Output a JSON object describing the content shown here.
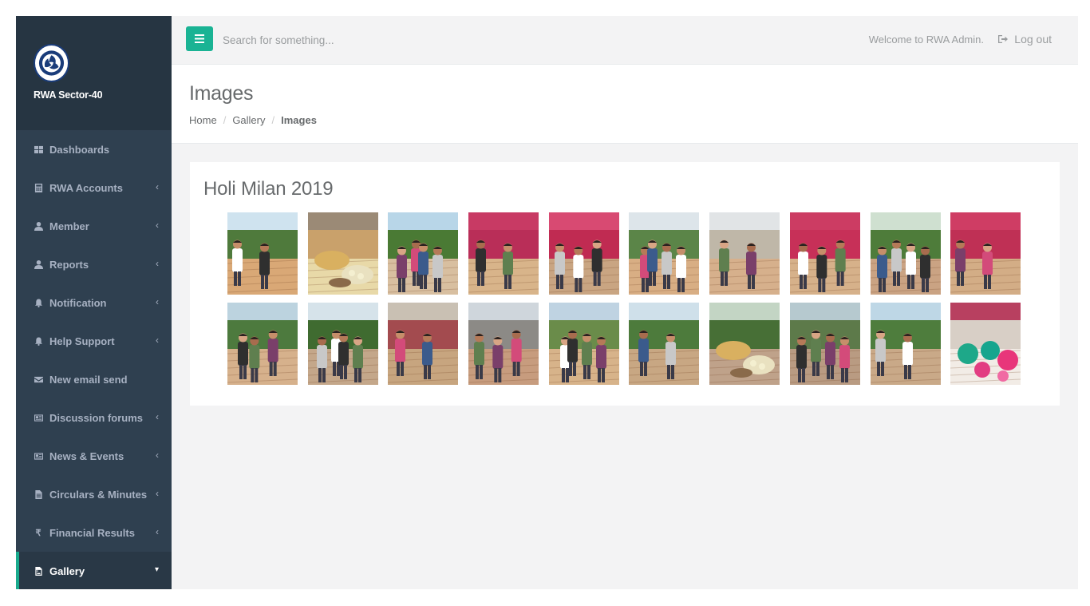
{
  "brand": {
    "org_name": "RWA Sector-40",
    "logo_icon": "rwa-emblem-icon"
  },
  "sidebar": {
    "items": [
      {
        "label": "Dashboards",
        "icon": "dashboard-icon",
        "has_submenu": false
      },
      {
        "label": "RWA Accounts",
        "icon": "calculator-icon",
        "has_submenu": true
      },
      {
        "label": "Member",
        "icon": "user-icon",
        "has_submenu": true
      },
      {
        "label": "Reports",
        "icon": "user-icon",
        "has_submenu": true
      },
      {
        "label": "Notification",
        "icon": "bell-icon",
        "has_submenu": true
      },
      {
        "label": "Help Support",
        "icon": "bell-icon",
        "has_submenu": true
      },
      {
        "label": "New email send",
        "icon": "envelope-icon",
        "has_submenu": false
      },
      {
        "label": "Discussion forums",
        "icon": "newspaper-icon",
        "has_submenu": true
      },
      {
        "label": "News & Events",
        "icon": "newspaper-icon",
        "has_submenu": true
      },
      {
        "label": "Circulars & Minutes",
        "icon": "file-icon",
        "has_submenu": true
      },
      {
        "label": "Financial Results",
        "icon": "rupee-icon",
        "has_submenu": true
      },
      {
        "label": "Gallery",
        "icon": "image-file-icon",
        "has_submenu": true,
        "active": true
      }
    ]
  },
  "topbar": {
    "search_placeholder": "Search for something...",
    "welcome_text": "Welcome to RWA Admin.",
    "logout_label": "Log out",
    "accent_color": "#1ab394"
  },
  "page": {
    "title": "Images",
    "breadcrumb": [
      "Home",
      "Gallery",
      "Images"
    ]
  },
  "album": {
    "title": "Holi Milan 2019",
    "photo_count": 20
  },
  "colors": {
    "sidebar_bg": "#2f4050",
    "sidebar_text": "#a7b1c2",
    "active_border": "#19aa8d",
    "page_bg": "#f3f3f4"
  }
}
